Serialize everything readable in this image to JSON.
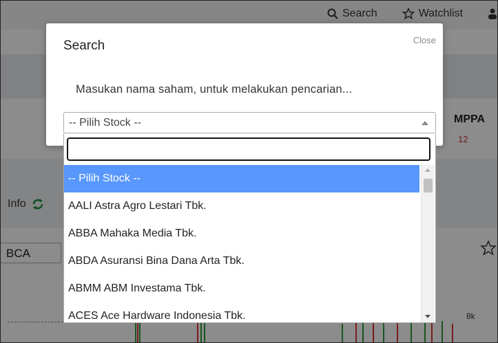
{
  "background": {
    "nav": {
      "search_label": "Search",
      "watchlist_label": "Watchlist"
    },
    "ticker_code": "MPPA",
    "ticker_change": "12",
    "info_label": "Info",
    "stock_input_value": "BCA",
    "chart_axis_label": "8k"
  },
  "modal": {
    "title": "Search",
    "close_label": "Close",
    "prompt": "Masukan nama saham, untuk melakukan pencarian...",
    "select": {
      "selected_label": "-- Pilih Stock --",
      "search_value": "",
      "options": [
        "-- Pilih Stock --",
        "AALI Astra Agro Lestari Tbk.",
        "ABBA Mahaka Media Tbk.",
        "ABDA Asuransi Bina Dana Arta Tbk.",
        "ABMM ABM Investama Tbk.",
        "ACES Ace Hardware Indonesia Tbk."
      ]
    }
  },
  "colors": {
    "highlight": "#5897fb",
    "overlay": "rgba(0,0,0,0.45)"
  }
}
